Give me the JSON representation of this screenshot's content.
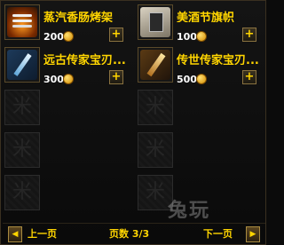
{
  "items": [
    {
      "name": "蒸汽香肠烤架",
      "price": "200",
      "icon": "grill-icon"
    },
    {
      "name": "美酒节旗帜",
      "price": "100",
      "icon": "banner-icon"
    },
    {
      "name": "远古传家宝刃...",
      "price": "300",
      "icon": "blade-icon"
    },
    {
      "name": "传世传家宝刃...",
      "price": "500",
      "icon": "blade-icon"
    }
  ],
  "footer": {
    "prev_label": "上一页",
    "next_label": "下一页",
    "page_label": "页数 3/3"
  },
  "watermark": "兔玩",
  "empty_slot_mark": "米",
  "plus_symbol": "+",
  "colors": {
    "name_text": "#ffd500",
    "price_text": "#ffffff",
    "background": "#0b0b0b"
  }
}
